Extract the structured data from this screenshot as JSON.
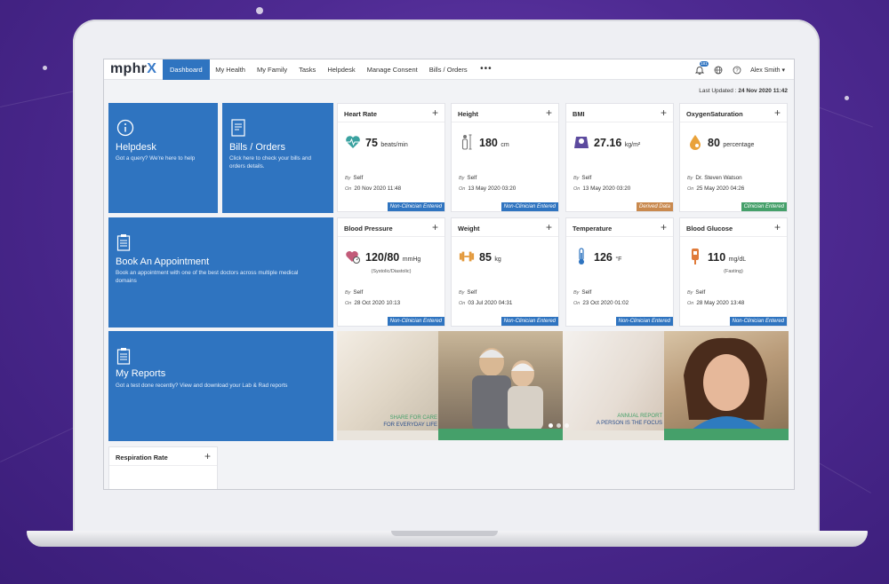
{
  "app": {
    "logo_main": "mphr",
    "logo_accent": "X",
    "user": "Alex Smith ▾",
    "notif_count": "181"
  },
  "nav": [
    "Dashboard",
    "My Health",
    "My Family",
    "Tasks",
    "Helpdesk",
    "Manage Consent",
    "Bills / Orders"
  ],
  "more": "•••",
  "updated": {
    "label": "Last Updated : ",
    "value": "24 Nov 2020 11:42"
  },
  "tiles": {
    "helpdesk": {
      "title": "Helpdesk",
      "sub": "Got a query? We're here to help"
    },
    "bills": {
      "title": "Bills / Orders",
      "sub1": "Click here to check your bills and",
      "sub2": "orders details."
    },
    "appointment": {
      "title": "Book An Appointment",
      "sub1": "Book an appointment with one of the best doctors across multiple medical",
      "sub2": "domains"
    },
    "reports": {
      "title": "My Reports",
      "sub": "Got a test done recently? View and download your Lab & Rad reports"
    }
  },
  "cards": [
    {
      "title": "Heart Rate",
      "value": "75",
      "unit": "beats/min",
      "note": "",
      "by": "Self",
      "on": "20 Nov 2020 11:48",
      "tag": "Non-Clinician Entered",
      "tag_color": "#2f74c0",
      "icon": "heart-icon"
    },
    {
      "title": "Height",
      "value": "180",
      "unit": "cm",
      "note": "",
      "by": "Self",
      "on": "13 May 2020 03:20",
      "tag": "Non-Clinician Entered",
      "tag_color": "#2f74c0",
      "icon": "height-icon"
    },
    {
      "title": "BMI",
      "value": "27.16",
      "unit": "kg/m²",
      "note": "",
      "by": "Self",
      "on": "13 May 2020 03:20",
      "tag": "Derived Data",
      "tag_color": "#c9894e",
      "icon": "scale-icon"
    },
    {
      "title": "OxygenSaturation",
      "value": "80",
      "unit": "percentage",
      "note": "",
      "by": "Dr. Steven Watson",
      "on": "25 May 2020 04:26",
      "tag": "Clinician Entered",
      "tag_color": "#45a06a",
      "icon": "drop-icon"
    },
    {
      "title": "Blood Pressure",
      "value": "120/80",
      "unit": "mmHg",
      "note": "(Systolic/Diastolic)",
      "by": "Self",
      "on": "28 Oct 2020 10:13",
      "tag": "Non-Clinician Entered",
      "tag_color": "#2f74c0",
      "icon": "bp-icon"
    },
    {
      "title": "Weight",
      "value": "85",
      "unit": "kg",
      "note": "",
      "by": "Self",
      "on": "03 Jul 2020 04:31",
      "tag": "Non-Clinician Entered",
      "tag_color": "#2f74c0",
      "icon": "dumbbell-icon"
    },
    {
      "title": "Temperature",
      "value": "126",
      "unit": "°F",
      "note": "",
      "by": "Self",
      "on": "23 Oct 2020 01:02",
      "tag": "Non-Clinician Entered",
      "tag_color": "#2f74c0",
      "icon": "thermometer-icon"
    },
    {
      "title": "Blood Glucose",
      "value": "110",
      "unit": "mg/dL",
      "note": "(Fasting)",
      "by": "Self",
      "on": "28 May 2020 13:48",
      "tag": "Non-Clinician Entered",
      "tag_color": "#2f74c0",
      "icon": "glucose-icon"
    }
  ],
  "by_label": "By",
  "on_label": "On",
  "banner": {
    "left1": "SHARE FOR CARE",
    "left2": "FOR EVERYDAY LIFE",
    "right1": "ANNUAL REPORT",
    "right2": "A PERSON IS THE FOCUS"
  },
  "respiration": {
    "title": "Respiration Rate"
  },
  "plus": "+"
}
